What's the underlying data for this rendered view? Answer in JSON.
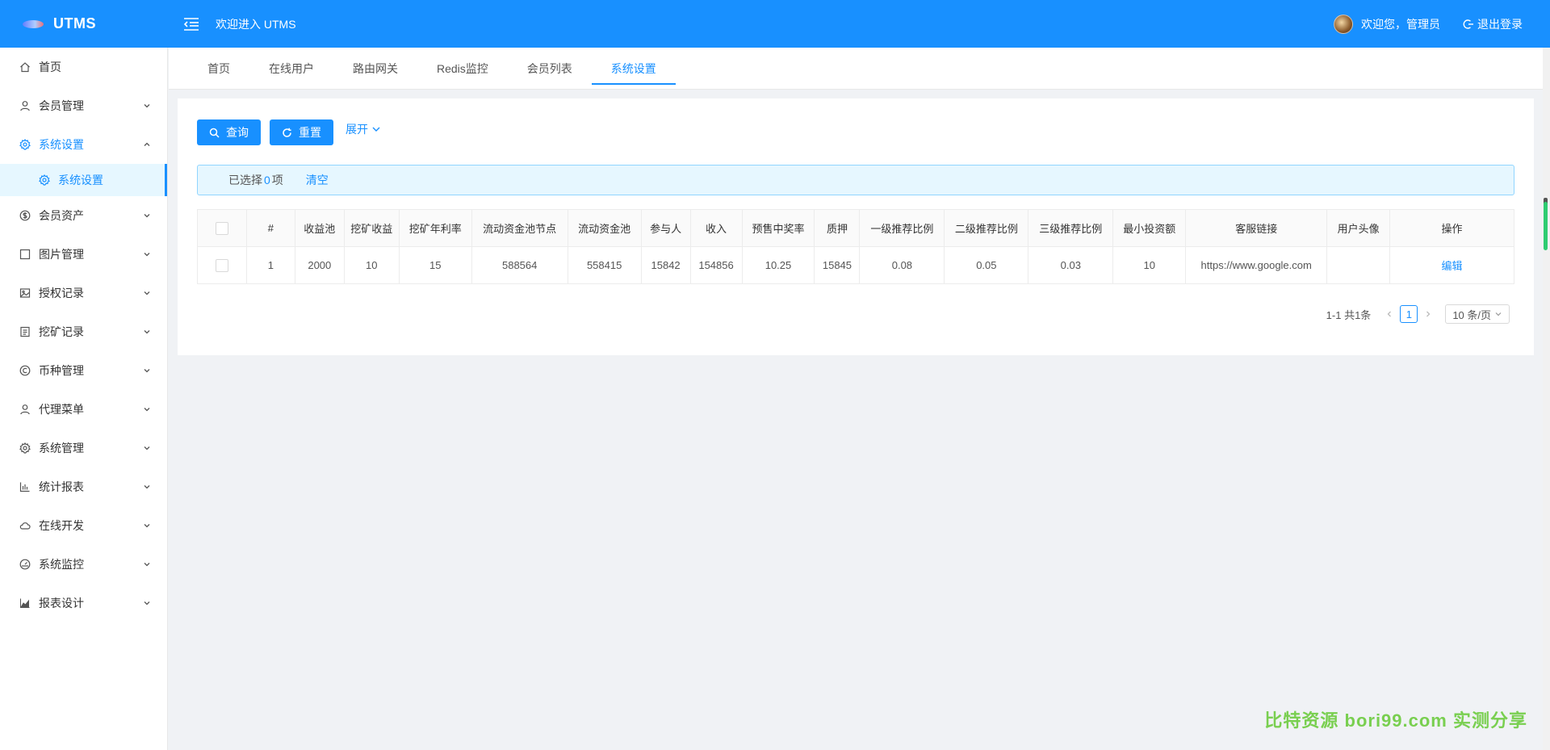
{
  "app": {
    "name": "UTMS",
    "welcome_title": "欢迎进入 UTMS"
  },
  "user": {
    "greeting": "欢迎您，管理员",
    "logout": "退出登录"
  },
  "sidebar": {
    "items": [
      {
        "label": "首页",
        "icon": "home-icon"
      },
      {
        "label": "会员管理",
        "icon": "user-icon"
      },
      {
        "label": "系统设置",
        "icon": "gear-icon",
        "open": true
      },
      {
        "label": "会员资产",
        "icon": "dollar-icon"
      },
      {
        "label": "图片管理",
        "icon": "square-icon"
      },
      {
        "label": "授权记录",
        "icon": "picture-icon"
      },
      {
        "label": "挖矿记录",
        "icon": "list-icon"
      },
      {
        "label": "币种管理",
        "icon": "copyright-icon"
      },
      {
        "label": "代理菜单",
        "icon": "user-icon"
      },
      {
        "label": "系统管理",
        "icon": "gear-icon"
      },
      {
        "label": "统计报表",
        "icon": "bar-chart-icon"
      },
      {
        "label": "在线开发",
        "icon": "cloud-icon"
      },
      {
        "label": "系统监控",
        "icon": "dashboard-icon"
      },
      {
        "label": "报表设计",
        "icon": "area-chart-icon"
      }
    ],
    "sub_item": {
      "label": "系统设置"
    }
  },
  "tabs": [
    {
      "label": "首页"
    },
    {
      "label": "在线用户"
    },
    {
      "label": "路由网关"
    },
    {
      "label": "Redis监控"
    },
    {
      "label": "会员列表"
    },
    {
      "label": "系统设置",
      "active": true
    }
  ],
  "toolbar": {
    "query_label": "查询",
    "reset_label": "重置",
    "expand_label": "展开"
  },
  "alert": {
    "prefix": "已选择 ",
    "count": "0",
    "suffix": "项",
    "clear": "清空"
  },
  "table": {
    "headers": [
      "#",
      "收益池",
      "挖矿收益",
      "挖矿年利率",
      "流动资金池节点",
      "流动资金池",
      "参与人",
      "收入",
      "预售中奖率",
      "质押",
      "一级推荐比例",
      "二级推荐比例",
      "三级推荐比例",
      "最小投资额",
      "客服链接",
      "用户头像",
      "操作"
    ],
    "rows": [
      [
        "1",
        "2000",
        "10",
        "15",
        "588564",
        "558415",
        "15842",
        "154856",
        "10.25",
        "15845",
        "0.08",
        "0.05",
        "0.03",
        "10",
        "https://www.google.com",
        "",
        "编辑"
      ]
    ]
  },
  "pagination": {
    "summary": "1-1 共1条",
    "current": "1",
    "page_size": "10 条/页"
  },
  "watermark": "比特资源 bori99.com 实测分享",
  "colors": {
    "primary": "#1890ff",
    "watermark": "#52c41a"
  }
}
